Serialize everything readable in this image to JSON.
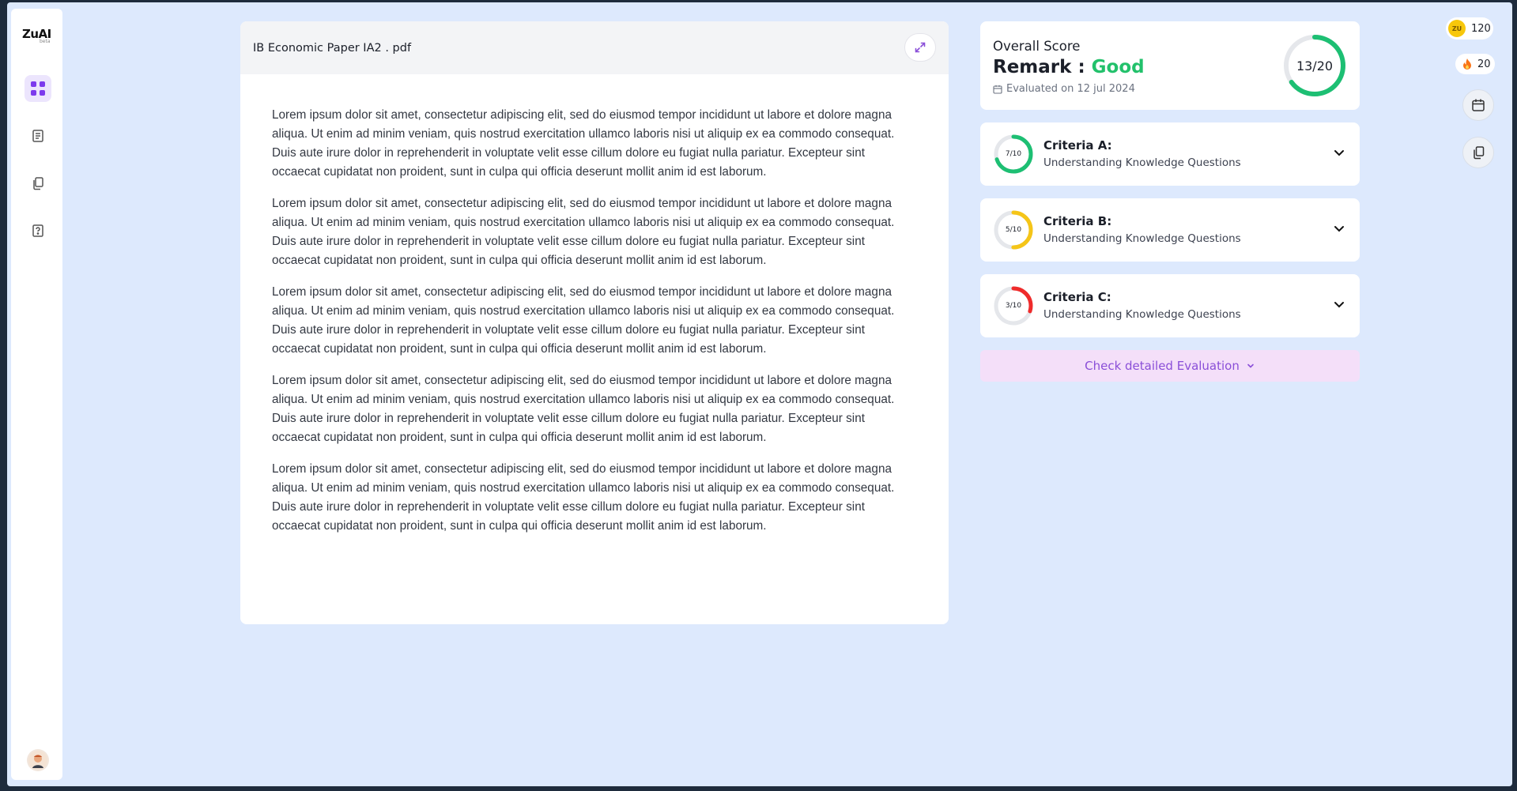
{
  "sidebar": {
    "logo": "ZuAI",
    "logo_sub": "beta",
    "items": [
      {
        "icon": "dashboard-grid-icon",
        "active": true
      },
      {
        "icon": "notebook-icon",
        "active": false
      },
      {
        "icon": "copy-documents-icon",
        "active": false
      },
      {
        "icon": "question-file-icon",
        "active": false
      }
    ]
  },
  "document": {
    "title": "IB Economic Paper IA2 . pdf",
    "paragraphs": [
      "Lorem ipsum dolor sit amet, consectetur adipiscing elit, sed do eiusmod tempor incididunt ut labore et dolore magna aliqua. Ut enim ad minim veniam, quis nostrud exercitation ullamco laboris nisi ut aliquip ex ea commodo consequat. Duis aute irure dolor in reprehenderit in voluptate velit esse cillum dolore eu fugiat nulla pariatur. Excepteur sint occaecat cupidatat non proident, sunt in culpa qui officia deserunt mollit anim id est laborum.",
      "Lorem ipsum dolor sit amet, consectetur adipiscing elit, sed do eiusmod tempor incididunt ut labore et dolore magna aliqua. Ut enim ad minim veniam, quis nostrud exercitation ullamco laboris nisi ut aliquip ex ea commodo consequat. Duis aute irure dolor in reprehenderit in voluptate velit esse cillum dolore eu fugiat nulla pariatur. Excepteur sint occaecat cupidatat non proident, sunt in culpa qui officia deserunt mollit anim id est laborum.",
      "Lorem ipsum dolor sit amet, consectetur adipiscing elit, sed do eiusmod tempor incididunt ut labore et dolore magna aliqua. Ut enim ad minim veniam, quis nostrud exercitation ullamco laboris nisi ut aliquip ex ea commodo consequat. Duis aute irure dolor in reprehenderit in voluptate velit esse cillum dolore eu fugiat nulla pariatur. Excepteur sint occaecat cupidatat non proident, sunt in culpa qui officia deserunt mollit anim id est laborum.",
      "Lorem ipsum dolor sit amet, consectetur adipiscing elit, sed do eiusmod tempor incididunt ut labore et dolore magna aliqua. Ut enim ad minim veniam, quis nostrud exercitation ullamco laboris nisi ut aliquip ex ea commodo consequat. Duis aute irure dolor in reprehenderit in voluptate velit esse cillum dolore eu fugiat nulla pariatur. Excepteur sint occaecat cupidatat non proident, sunt in culpa qui officia deserunt mollit anim id est laborum.",
      "Lorem ipsum dolor sit amet, consectetur adipiscing elit, sed do eiusmod tempor incididunt ut labore et dolore magna aliqua. Ut enim ad minim veniam, quis nostrud exercitation ullamco laboris nisi ut aliquip ex ea commodo consequat. Duis aute irure dolor in reprehenderit in voluptate velit esse cillum dolore eu fugiat nulla pariatur. Excepteur sint occaecat cupidatat non proident, sunt in culpa qui officia deserunt mollit anim id est laborum."
    ]
  },
  "score": {
    "label": "Overall Score",
    "remark_prefix": "Remark :",
    "remark": "Good",
    "evaluated": "Evaluated on 12 jul 2024",
    "value_text": "13/20",
    "fraction": 0.65,
    "color": "#1dbf73"
  },
  "criteria": [
    {
      "title": "Criteria A:",
      "subtitle": "Understanding Knowledge Questions",
      "score_text": "7/10",
      "fraction": 0.7,
      "color": "#1dbf73"
    },
    {
      "title": "Criteria B:",
      "subtitle": "Understanding Knowledge Questions",
      "score_text": "5/10",
      "fraction": 0.5,
      "color": "#f5c518"
    },
    {
      "title": "Criteria C:",
      "subtitle": "Understanding Knowledge Questions",
      "score_text": "3/10",
      "fraction": 0.3,
      "color": "#ef2b2b"
    }
  ],
  "check_button": "Check detailed Evaluation",
  "widgets": {
    "coins": "120",
    "coin_label": "ZU",
    "streak": "20"
  },
  "colors": {
    "accent": "#8a4fd8",
    "good": "#22c16b"
  }
}
